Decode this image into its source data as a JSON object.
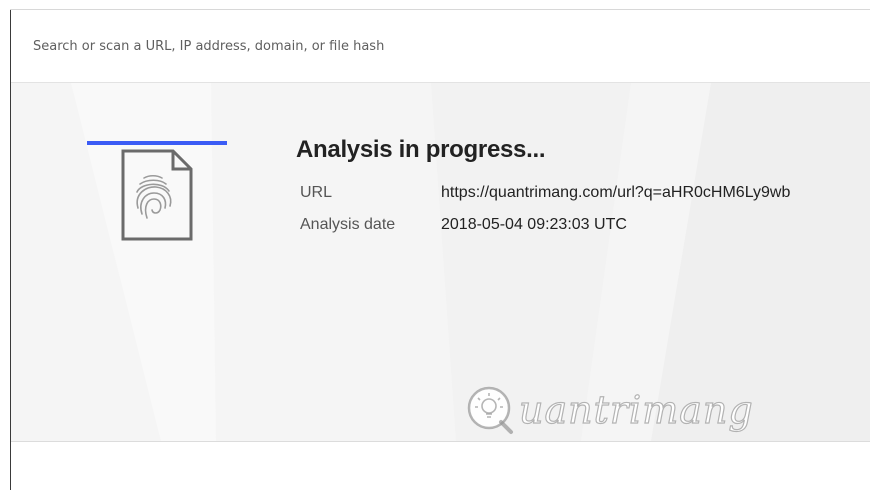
{
  "search": {
    "placeholder": "Search or scan a URL, IP address, domain, or file hash"
  },
  "analysis": {
    "progress": 1.0,
    "progress_color": "#3b5cf5",
    "file_icon": "fingerprint-file-icon",
    "title": "Analysis in progress...",
    "url_label": "URL",
    "url_value": "https://quantrimang.com/url?q=aHR0cHM6Ly9wb",
    "date_label": "Analysis date",
    "date_value": "2018-05-04 09:23:03 UTC"
  },
  "watermark": {
    "text": "uantrimang",
    "icon": "lightbulb-q-icon"
  }
}
